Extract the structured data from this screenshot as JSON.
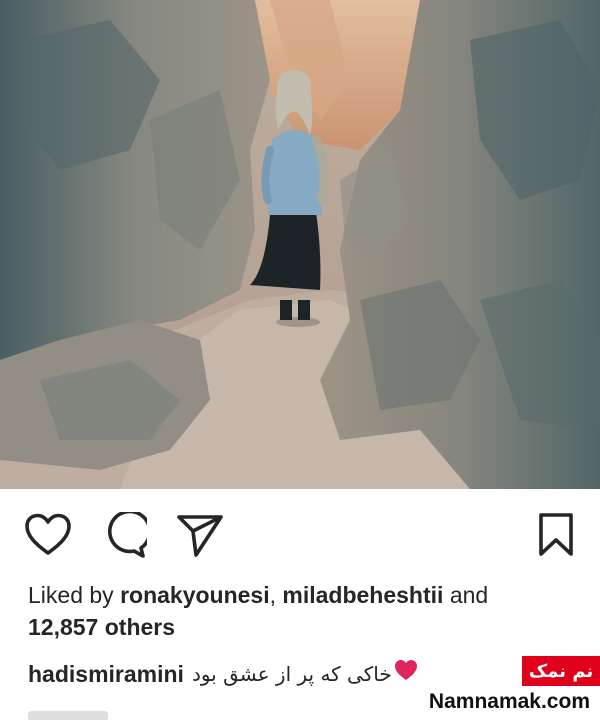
{
  "post": {
    "photo_alt": "Woman standing in a narrow rocky canyon",
    "likes": {
      "prefix": "Liked by ",
      "user1": "ronakyounesi",
      "separator": ", ",
      "user2": "miladbeheshtii",
      "and": " and",
      "count": "12,857 others"
    },
    "caption": {
      "username": "hadismiramini",
      "text": "خاکی که پر از عشق بود"
    }
  },
  "icons": {
    "like": "heart-outline-icon",
    "comment": "comment-bubble-icon",
    "share": "paper-plane-icon",
    "save": "bookmark-icon",
    "caption_emoji": "red-heart-icon"
  },
  "watermark": {
    "badge": "نم نمک",
    "site": "Namnamak.com"
  },
  "colors": {
    "text": "#262626",
    "badge_red": "#e0001b",
    "heart_red": "#e0245e"
  }
}
